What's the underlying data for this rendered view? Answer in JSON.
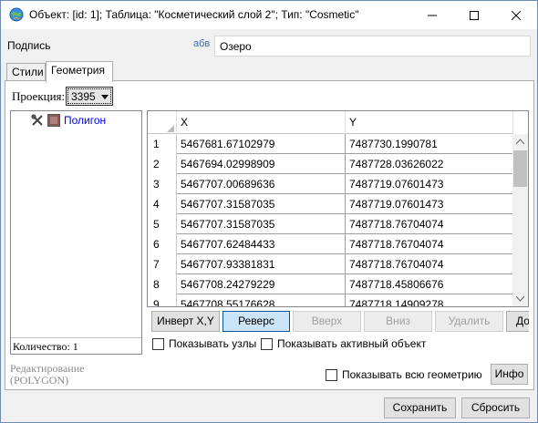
{
  "window": {
    "title": "Объект: [id: 1]; Таблица: \"Косметический слой 2\"; Тип: \"Cosmetic\""
  },
  "caption": {
    "label": "Подпись",
    "prefix": "абв",
    "value": "Озеро"
  },
  "tabs": [
    {
      "label": "Стили",
      "active": false
    },
    {
      "label": "Геометрия",
      "active": true
    }
  ],
  "geometry": {
    "projection_label": "Проекция:",
    "projection_value": "3395",
    "tree_item": "Полигон",
    "count_label": "Количество: 1",
    "columns": [
      "X",
      "Y"
    ],
    "rows": [
      {
        "n": "1",
        "x": "5467681.67102979",
        "y": "7487730.1990781"
      },
      {
        "n": "2",
        "x": "5467694.02998909",
        "y": "7487728.03626022"
      },
      {
        "n": "3",
        "x": "5467707.00689636",
        "y": "7487719.07601473"
      },
      {
        "n": "4",
        "x": "5467707.31587035",
        "y": "7487719.07601473"
      },
      {
        "n": "5",
        "x": "5467707.31587035",
        "y": "7487718.76704074"
      },
      {
        "n": "6",
        "x": "5467707.62484433",
        "y": "7487718.76704074"
      },
      {
        "n": "7",
        "x": "5467707.93381831",
        "y": "7487718.76704074"
      },
      {
        "n": "8",
        "x": "5467708.24279229",
        "y": "7487718.45806676"
      },
      {
        "n": "9",
        "x": "5467708.55176628",
        "y": "7487718.14909278"
      }
    ],
    "buttons": {
      "invert": "Инверт X,Y",
      "reverse": "Реверс",
      "up": "Вверх",
      "down": "Вниз",
      "delete": "Удалить",
      "add": "До"
    },
    "show_nodes": "Показывать узлы",
    "show_active": "Показывать активный объект"
  },
  "footer": {
    "edit_mode": "Редактирование",
    "edit_type": "(POLYGON)",
    "show_all": "Показывать всю геометрию",
    "info": "Инфо",
    "save": "Сохранить",
    "reset": "Сбросить"
  },
  "colors": {
    "tree_link": "#0000ee",
    "accent": "#3c6cc4"
  }
}
